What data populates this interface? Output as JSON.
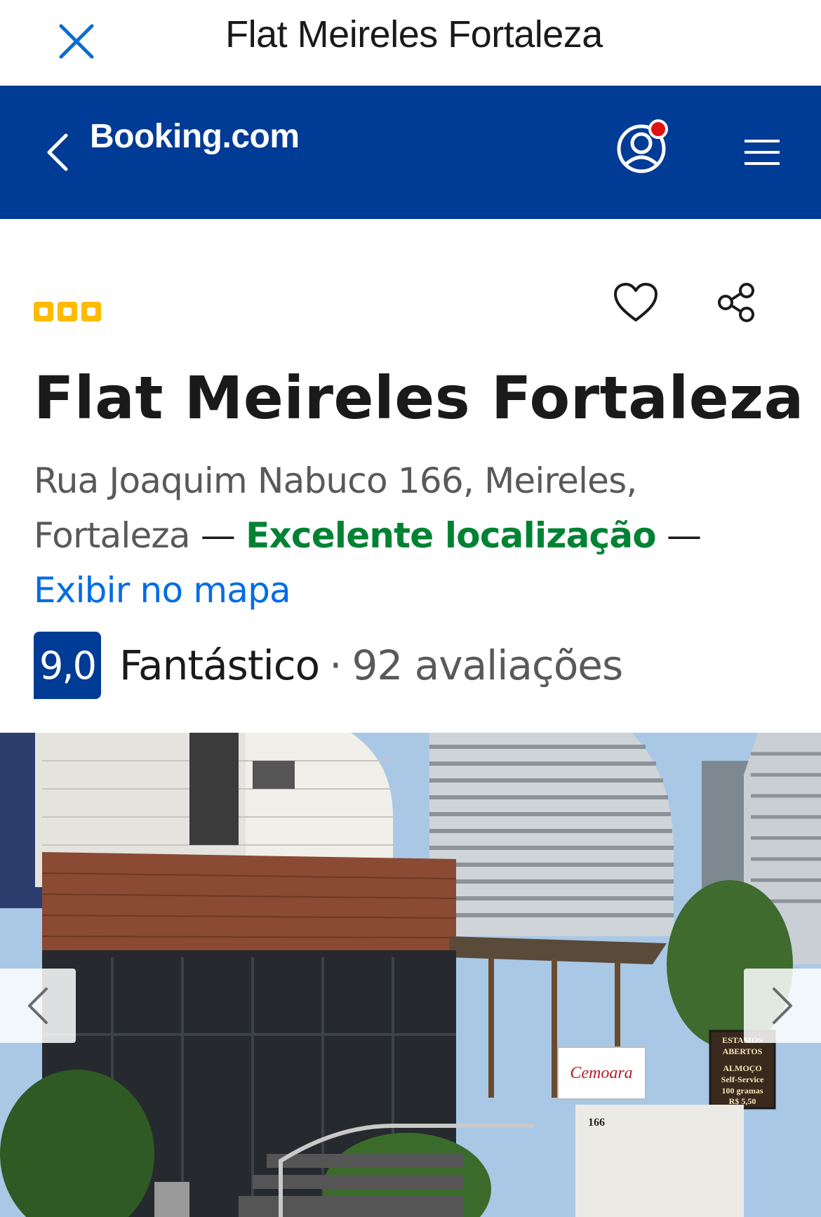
{
  "webview": {
    "title": "Flat Meireles Fortaleza",
    "close_icon": "close-icon"
  },
  "header": {
    "brand": "Booking.com",
    "back_icon": "chevron-left-icon",
    "account_icon": "account-icon",
    "menu_icon": "hamburger-menu-icon",
    "background_color": "#003b95",
    "notification_dot_color": "#e21111"
  },
  "property": {
    "star_rating": 3,
    "star_color": "#febb02",
    "name": "Flat Meireles Fortaleza",
    "address": "Rua Joaquim Nabuco 166, Meireles, Fortaleza",
    "dash1": "—",
    "location_tag": "Excelente localização",
    "dash2": "—",
    "map_link": "Exibir no mapa",
    "favorite_icon": "heart-icon",
    "share_icon": "share-icon"
  },
  "rating": {
    "score": "9,0",
    "label": "Fantástico",
    "separator": "·",
    "reviews": "92 avaliações"
  },
  "gallery": {
    "prev_icon": "chevron-left-icon",
    "next_icon": "chevron-right-icon",
    "photo_signs": {
      "restaurant_logo": "Cemoara",
      "board_line1": "ESTAMOS",
      "board_line2": "ABERTOS",
      "board_line3": "ALMOÇO",
      "board_line4": "Self-Service",
      "board_line5": "100 gramas",
      "board_line6": "R$ 5,50",
      "building_number": "166"
    }
  }
}
